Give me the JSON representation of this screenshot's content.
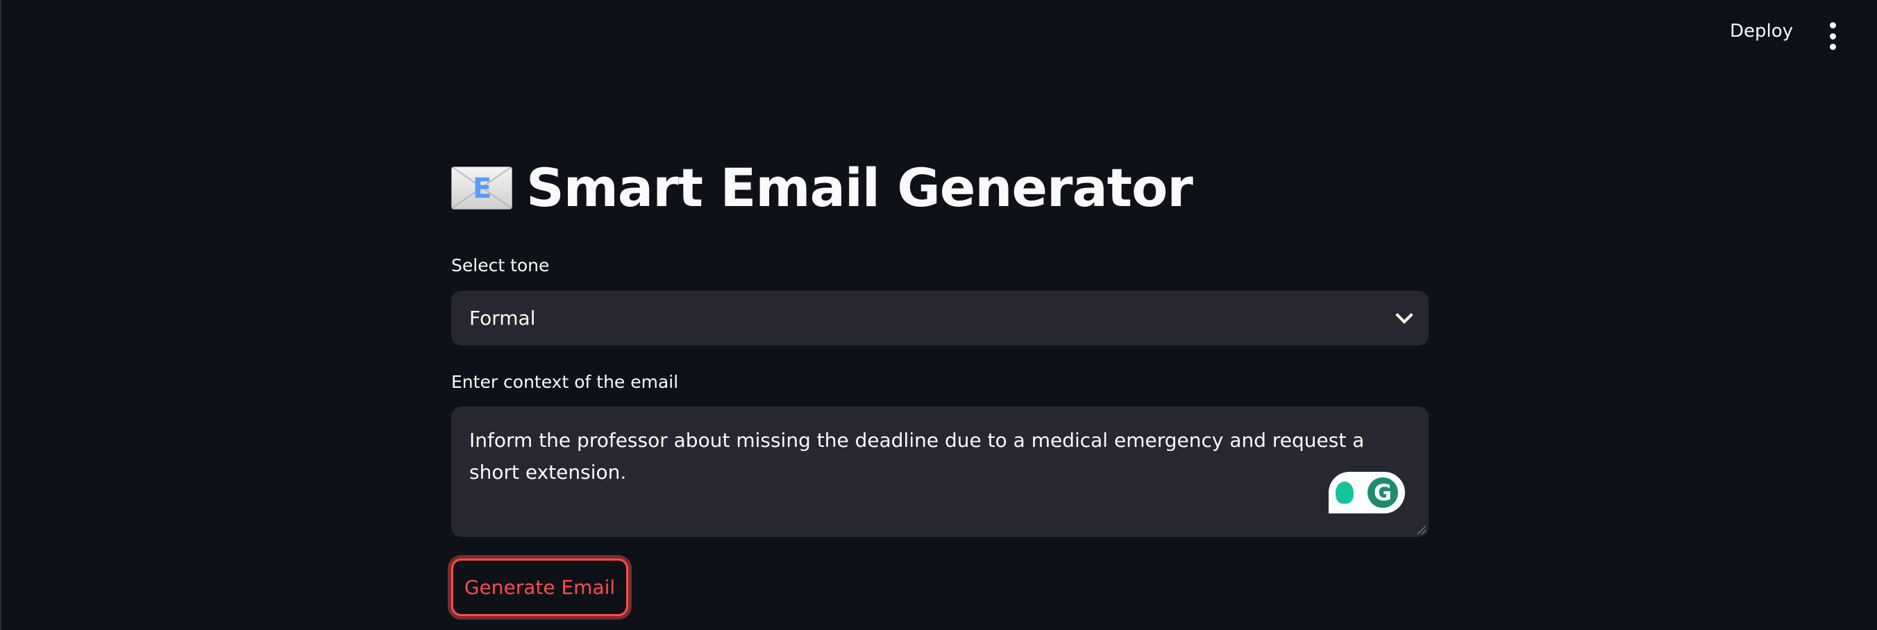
{
  "header": {
    "deploy_label": "Deploy",
    "menu_icon": "kebab-menu-icon"
  },
  "page": {
    "title_emoji": "e-mail envelope",
    "title": "Smart Email Generator"
  },
  "tone": {
    "label": "Select tone",
    "value": "Formal"
  },
  "context": {
    "label": "Enter context of the email",
    "value": "Inform the professor about missing the deadline due to a medical emergency and request a short extension.",
    "grammarly_letter": "G"
  },
  "actions": {
    "generate_label": "Generate Email"
  },
  "colors": {
    "background": "#0e1117",
    "input": "#262730",
    "accent": "#ff4b4b"
  }
}
